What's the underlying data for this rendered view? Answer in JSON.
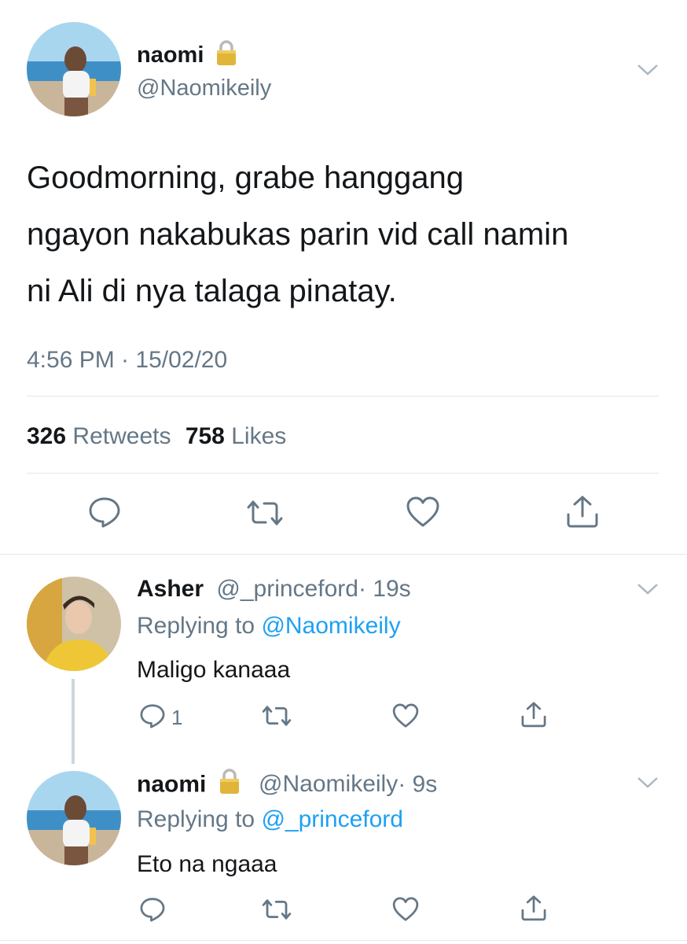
{
  "main_tweet": {
    "display_name": "naomi",
    "handle": "@Naomikeily",
    "text_lines": [
      "Goodmorning, grabe hanggang",
      "ngayon nakabukas parin vid call namin",
      "ni Ali di nya talaga pinatay."
    ],
    "timestamp": "4:56 PM · 15/02/20",
    "retweets_count": "326",
    "retweets_label": "Retweets",
    "likes_count": "758",
    "likes_label": "Likes"
  },
  "replies": [
    {
      "display_name": "Asher",
      "handle": "@_princeford",
      "time": "· 19s",
      "replying_prefix": "Replying to",
      "replying_to": "@Naomikeily",
      "text": "Maligo kanaaa",
      "reply_count": "1"
    },
    {
      "display_name": "naomi",
      "handle": "@Naomikeily",
      "time": "· 9s",
      "replying_prefix": "Replying to",
      "replying_to": "@_princeford",
      "text": "Eto na ngaaa",
      "reply_count": ""
    }
  ],
  "colors": {
    "accent": "#1da1f2",
    "secondary_text": "#657786",
    "divider": "#e1e8ed",
    "icon": "#657786"
  }
}
